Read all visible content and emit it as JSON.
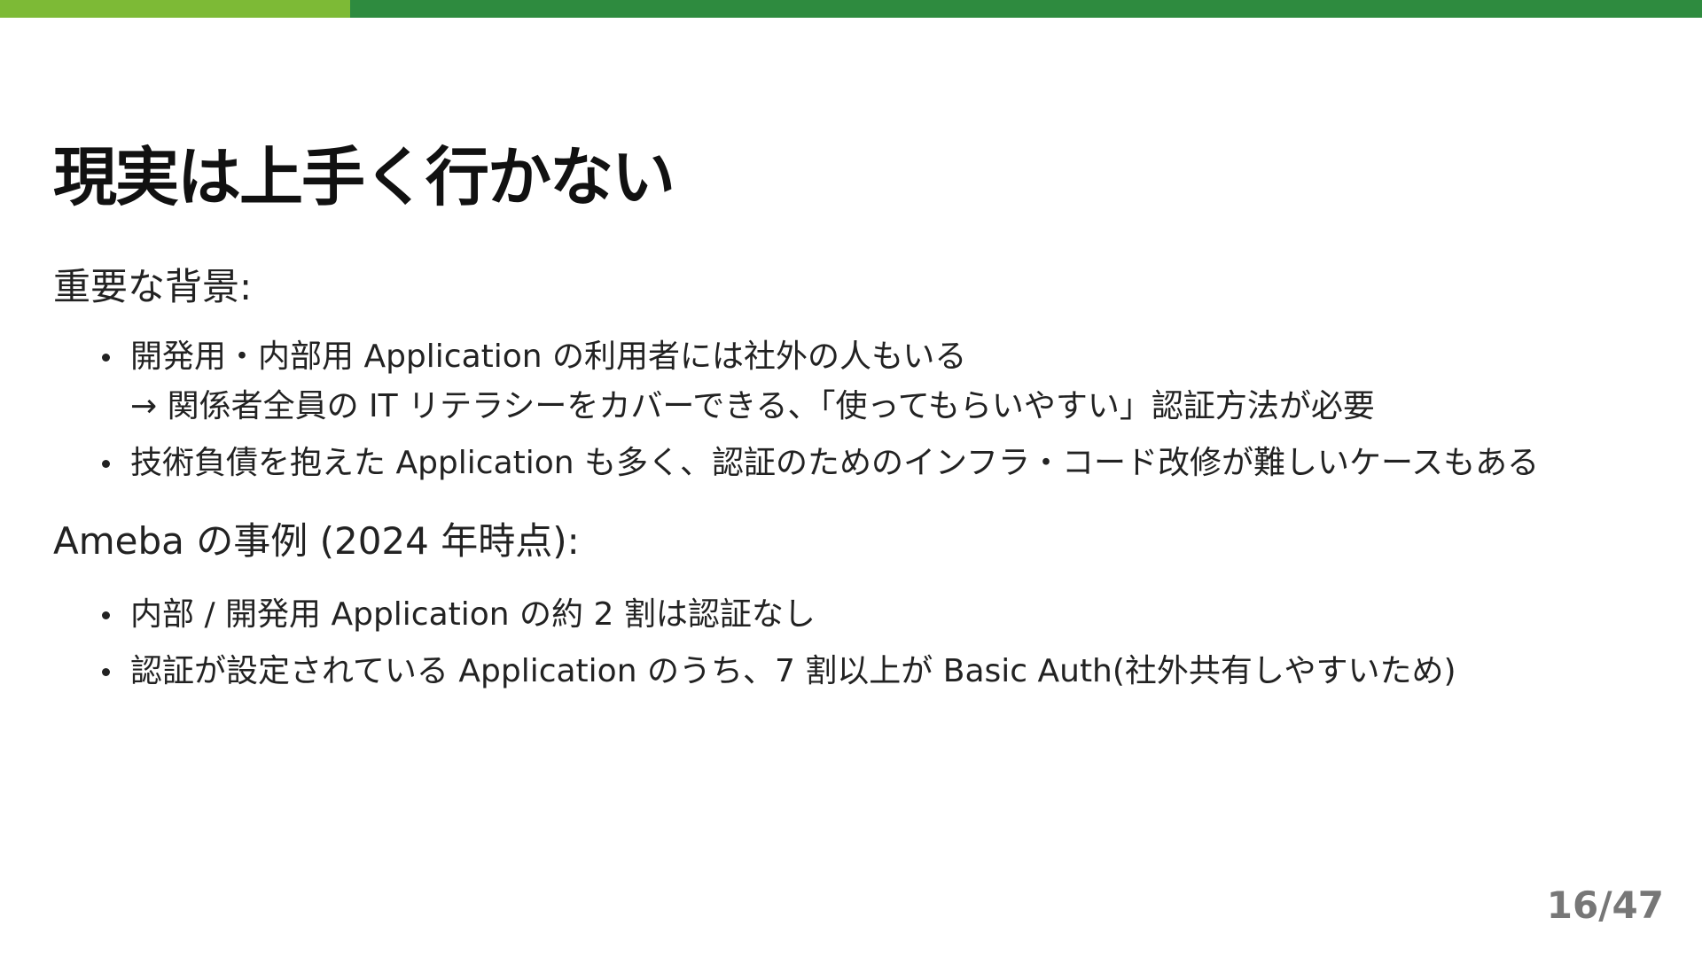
{
  "colors": {
    "accent_light": "#7dba36",
    "accent_dark": "#2e8b3f",
    "text": "#222222",
    "page_number": "#777777"
  },
  "slide": {
    "title": "現実は上手く行かない",
    "sections": [
      {
        "heading": "重要な背景:",
        "bullets": [
          {
            "text": "開発用・内部用 Application の利用者には社外の人もいる",
            "sub": "→ 関係者全員の IT リテラシーをカバーできる、「使ってもらいやすい」認証方法が必要"
          },
          {
            "text": "技術負債を抱えた Application も多く、認証のためのインフラ・コード改修が難しいケースもある"
          }
        ]
      },
      {
        "heading": "Ameba の事例 (2024 年時点):",
        "bullets": [
          {
            "text": "内部 / 開発用 Application の約 2 割は認証なし"
          },
          {
            "text": "認証が設定されている Application のうち、7 割以上が Basic Auth(社外共有しやすいため)"
          }
        ]
      }
    ]
  },
  "page_number": "16/47"
}
